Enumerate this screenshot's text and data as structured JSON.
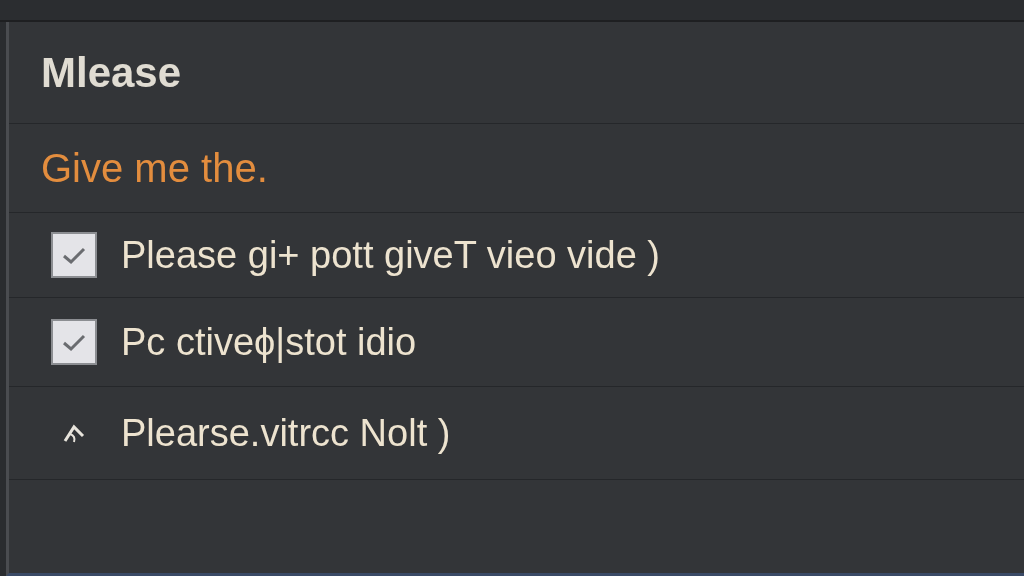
{
  "heading": "Mlease",
  "subheading": "Give me the.",
  "items": [
    {
      "kind": "checkbox",
      "label": "Please gi+ pott giveT vieo vide )",
      "checked": true
    },
    {
      "kind": "checkbox",
      "label": "Pc ctiveϕ|stot idio",
      "checked": true
    },
    {
      "kind": "icon",
      "label": "Plearse.vitrcc Nolt )"
    }
  ]
}
